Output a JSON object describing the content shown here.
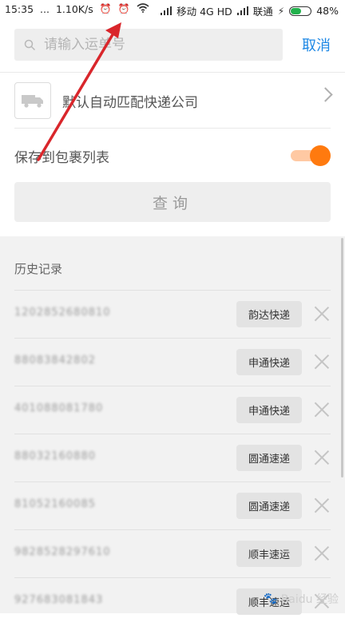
{
  "status_bar": {
    "time": "15:35",
    "dots": "...",
    "speed": "1.10K/s",
    "carrier1": "移动 4G HD",
    "carrier2": "联通",
    "battery": "48%",
    "battery_color": "#22b14c"
  },
  "search": {
    "placeholder": "请输入运单号",
    "value": "",
    "cancel_label": "取消",
    "icon": "search-icon"
  },
  "company": {
    "label": "默认自动匹配快递公司",
    "icon": "truck-icon"
  },
  "save_to_list": {
    "label": "保存到包裹列表",
    "enabled": true,
    "accent": "#ff7a0f"
  },
  "query_button": "查询",
  "history": {
    "title": "历史记录",
    "items": [
      {
        "number": "1202852680810",
        "company": "韵达快递"
      },
      {
        "number": "88083842802",
        "company": "申通快递"
      },
      {
        "number": "401088081780",
        "company": "申通快递"
      },
      {
        "number": "88032160880",
        "company": "圆通速递"
      },
      {
        "number": "81052160085",
        "company": "圆通速递"
      },
      {
        "number": "9828528297610",
        "company": "顺丰速运"
      },
      {
        "number": "927683081843",
        "company": "顺丰速运"
      }
    ]
  },
  "watermark": "Baidu 经验",
  "colors": {
    "link_blue": "#1e88e5",
    "annotation_arrow": "#d9262b"
  }
}
